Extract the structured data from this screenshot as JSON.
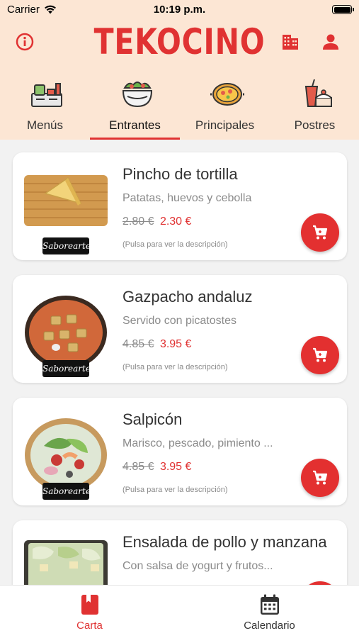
{
  "status_bar": {
    "carrier": "Carrier",
    "time": "10:19 p.m."
  },
  "app": {
    "logo": "TEKOCINO"
  },
  "tabs": [
    {
      "label": "Menús",
      "icon": "menu-tray-icon",
      "active": false
    },
    {
      "label": "Entrantes",
      "icon": "salad-bowl-icon",
      "active": true
    },
    {
      "label": "Principales",
      "icon": "paella-pan-icon",
      "active": false
    },
    {
      "label": "Postres",
      "icon": "drink-cake-icon",
      "active": false
    }
  ],
  "products": [
    {
      "title": "Pincho de tortilla",
      "subtitle": "Patatas, huevos y cebolla",
      "old_price": "2.80 €",
      "price": "2.30 €",
      "hint": "(Pulsa para ver la descripción)",
      "badge": "Saborearte"
    },
    {
      "title": "Gazpacho andaluz",
      "subtitle": "Servido con picatostes",
      "old_price": "4.85 €",
      "price": "3.95 €",
      "hint": "(Pulsa para ver la descripción)",
      "badge": "Saborearte"
    },
    {
      "title": "Salpicón",
      "subtitle": "Marisco, pescado, pimiento ...",
      "old_price": "4.85 €",
      "price": "3.95 €",
      "hint": "(Pulsa para ver la descripción)",
      "badge": "Saborearte"
    },
    {
      "title": "Ensalada de pollo y manzana",
      "subtitle": "Con salsa de yogurt y frutos...",
      "old_price": "",
      "price": "",
      "hint": "",
      "badge": ""
    }
  ],
  "bottom_nav": [
    {
      "label": "Carta",
      "icon": "book-icon",
      "active": true
    },
    {
      "label": "Calendario",
      "icon": "calendar-icon",
      "active": false
    }
  ],
  "colors": {
    "accent": "#e03232",
    "header_bg": "#fce6d4"
  }
}
